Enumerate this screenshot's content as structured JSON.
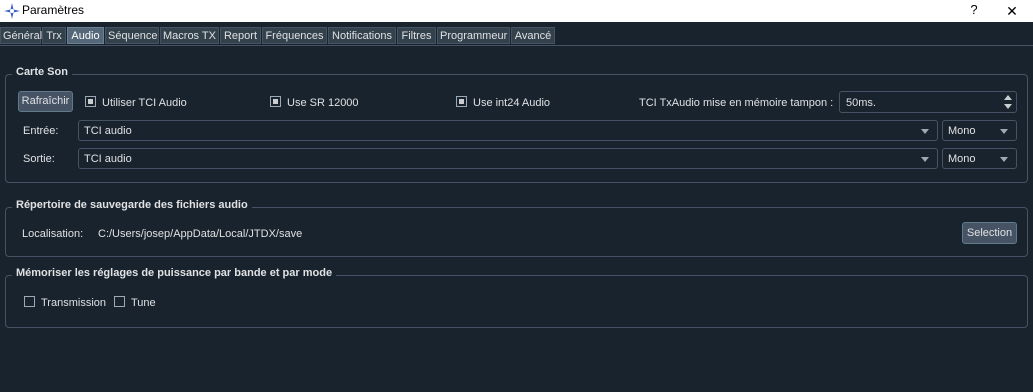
{
  "window": {
    "title": "Paramètres",
    "help": "?",
    "close": "✕"
  },
  "tabs": [
    {
      "label": "Général"
    },
    {
      "label": "Trx"
    },
    {
      "label": "Audio"
    },
    {
      "label": "Séquence"
    },
    {
      "label": "Macros TX"
    },
    {
      "label": "Report"
    },
    {
      "label": "Fréquences"
    },
    {
      "label": "Notifications"
    },
    {
      "label": "Filtres"
    },
    {
      "label": "Programmeur"
    },
    {
      "label": "Avancé"
    }
  ],
  "active_tab": "Audio",
  "sound_card": {
    "title": "Carte Son",
    "refresh_label": "Rafraîchir",
    "use_tci_audio": {
      "label": "Utiliser TCI Audio",
      "checked": true
    },
    "use_sr": {
      "label": "Use SR 12000",
      "checked": true
    },
    "use_int24": {
      "label": "Use int24 Audio",
      "checked": true
    },
    "buffer_label": "TCI TxAudio mise en mémoire tampon :",
    "buffer_value": "50ms.",
    "input_label": "Entrée:",
    "input_device": "TCI audio",
    "input_channel": "Mono",
    "output_label": "Sortie:",
    "output_device": "TCI audio",
    "output_channel": "Mono"
  },
  "save_dir": {
    "title": "Répertoire de sauvegarde des fichiers audio",
    "location_label": "Localisation:",
    "path": "C:/Users/josep/AppData/Local/JTDX/save",
    "select_label": "Selection"
  },
  "power": {
    "title": "Mémoriser les réglages de puissance par bande et par mode",
    "transmit": {
      "label": "Transmission",
      "checked": false
    },
    "tune": {
      "label": "Tune",
      "checked": false
    }
  }
}
